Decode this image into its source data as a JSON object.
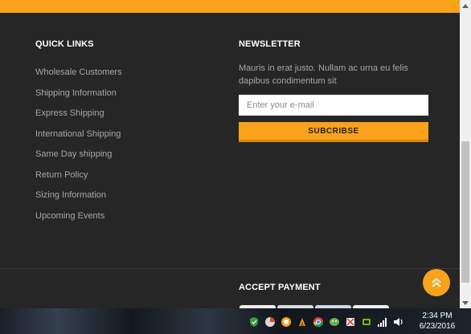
{
  "quick_links": {
    "title": "QUICK LINKS",
    "items": [
      {
        "label": "Wholesale Customers"
      },
      {
        "label": "Shipping Information"
      },
      {
        "label": "Express Shipping"
      },
      {
        "label": "International Shipping"
      },
      {
        "label": "Same Day shipping"
      },
      {
        "label": "Return Policy"
      },
      {
        "label": "Sizing Information"
      },
      {
        "label": "Upcoming Events"
      }
    ]
  },
  "newsletter": {
    "title": "NEWSLETTER",
    "text": "Mauris in erat justo. Nullam ac urna eu felis dapibus condimentum sit",
    "placeholder": "Enter your e-mail",
    "button_label": "SUBCRIBSE"
  },
  "accept_payment": {
    "title": "ACCEPT PAYMENT",
    "cards": [
      {
        "icon": "payment-card-icon"
      },
      {
        "icon": "payment-card-icon"
      },
      {
        "icon": "payment-card-icon"
      },
      {
        "icon": "payment-card-icon"
      }
    ]
  },
  "back_to_top": {
    "icon": "double-chevron-up-icon"
  },
  "taskbar": {
    "time": "2:34 PM",
    "date": "6/23/2016",
    "tray_icons": [
      "security-icon",
      "app-icon",
      "app-icon",
      "app-icon",
      "browser-icon",
      "app-icon",
      "app-icon",
      "app-icon",
      "network-signal-icon",
      "volume-icon"
    ]
  },
  "colors": {
    "accent": "#f9a21b",
    "background": "#262626",
    "link_text": "#a7a7a7",
    "heading_text": "#ffffff"
  }
}
